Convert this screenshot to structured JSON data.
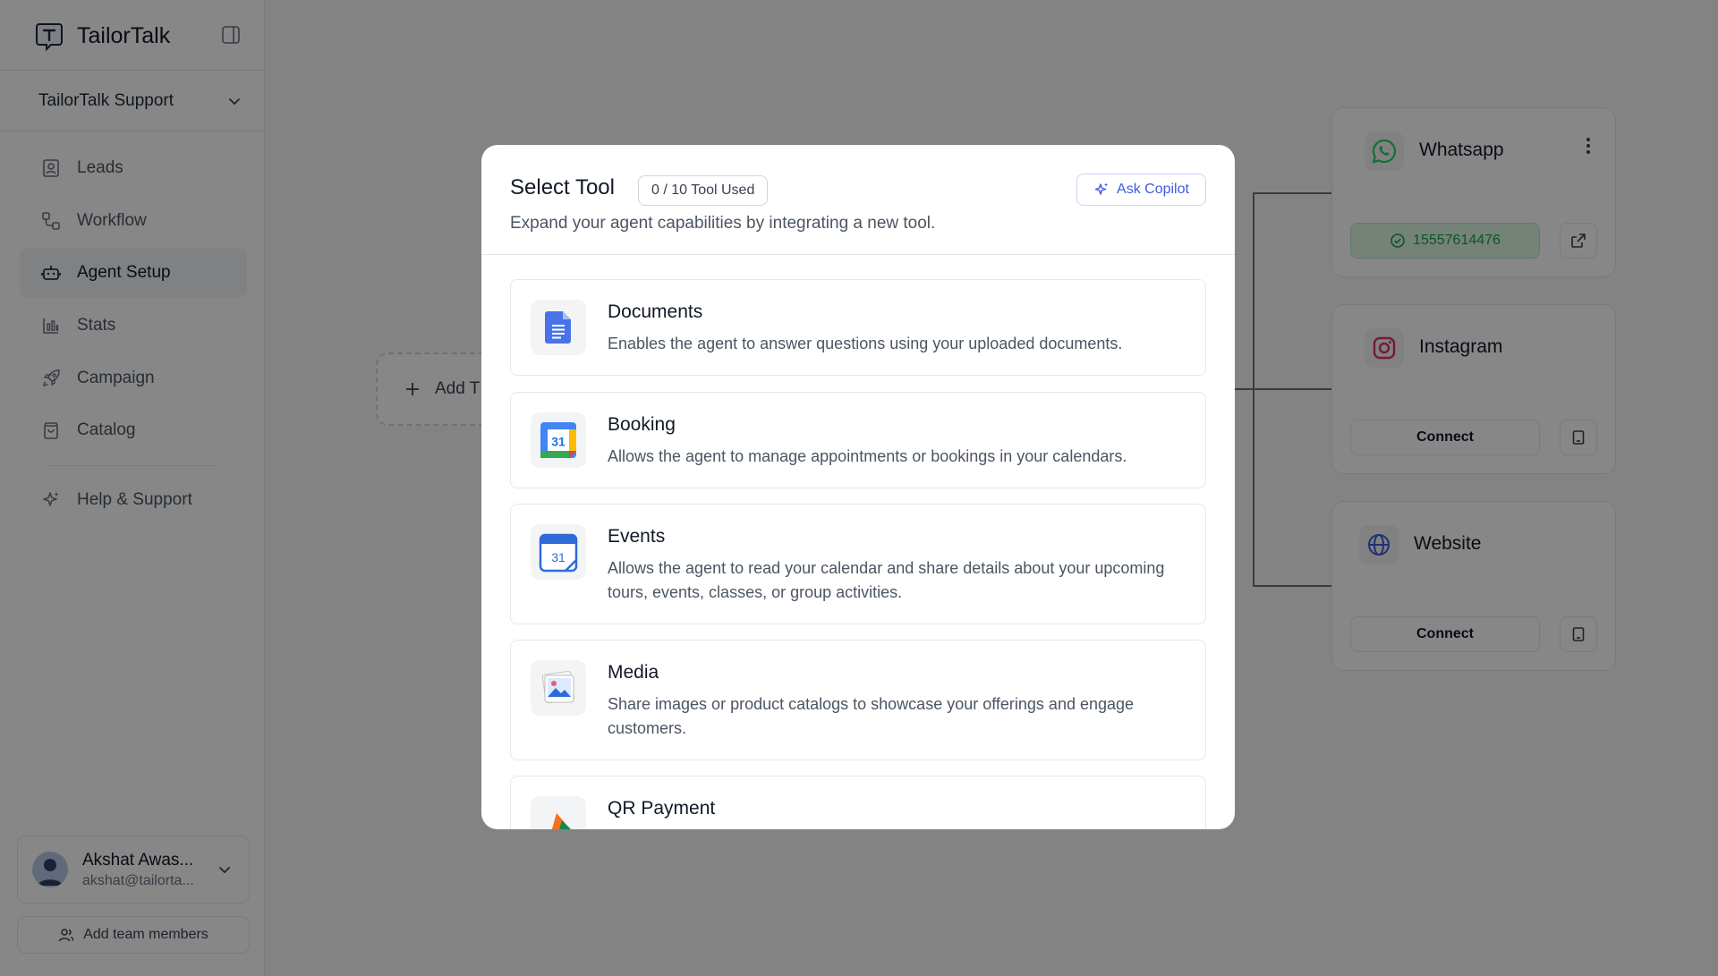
{
  "sidebar": {
    "brand": "TailorTalk",
    "workspace": "TailorTalk Support",
    "nav": [
      {
        "label": "Leads",
        "icon": "contact-icon"
      },
      {
        "label": "Workflow",
        "icon": "workflow-icon"
      },
      {
        "label": "Agent Setup",
        "icon": "bot-icon",
        "active": true
      },
      {
        "label": "Stats",
        "icon": "bar-chart-icon"
      },
      {
        "label": "Campaign",
        "icon": "rocket-icon"
      },
      {
        "label": "Catalog",
        "icon": "shopping-bag-icon"
      }
    ],
    "help": "Help & Support",
    "user": {
      "name": "Akshat Awas...",
      "email": "akshat@tailorta..."
    },
    "add_team": "Add team members"
  },
  "canvas": {
    "add_tool_label": "Add T",
    "channels": [
      {
        "name": "Whatsapp",
        "status_text": "15557614476",
        "color": "#25d366"
      },
      {
        "name": "Instagram",
        "button": "Connect",
        "color": "#e1306c"
      },
      {
        "name": "Website",
        "button": "Connect",
        "color": "#3b5bdb"
      }
    ]
  },
  "modal": {
    "title": "Select Tool",
    "usage": "0 / 10 Tool Used",
    "copilot": "Ask Copilot",
    "subtitle": "Expand your agent capabilities by integrating a new tool.",
    "tools": [
      {
        "name": "Documents",
        "description": "Enables the agent to answer questions using your uploaded documents.",
        "icon": "google-docs-icon"
      },
      {
        "name": "Booking",
        "description": "Allows the agent to manage appointments or bookings in your calendars.",
        "icon": "google-calendar-icon"
      },
      {
        "name": "Events",
        "description": "Allows the agent to read your calendar and share details about your upcoming tours, events, classes, or group activities.",
        "icon": "calendar-icon"
      },
      {
        "name": "Media",
        "description": "Share images or product catalogs to showcase your offerings and engage customers.",
        "icon": "photos-icon"
      },
      {
        "name": "QR Payment",
        "description": "",
        "icon": "upi-icon"
      }
    ]
  },
  "colors": {
    "overlay": "rgba(0,0,0,0.47)",
    "accent": "#3b5bdb"
  }
}
